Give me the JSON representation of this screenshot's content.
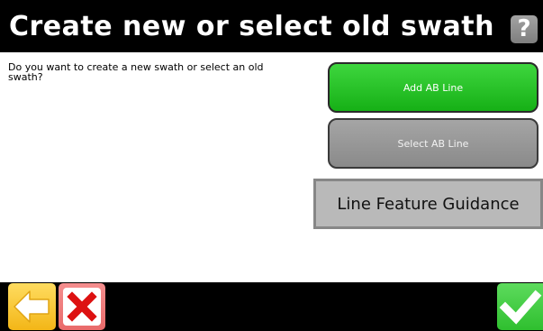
{
  "header": {
    "title": "Create new or select old swath",
    "help_icon": "question-mark-icon",
    "help_label": "?"
  },
  "main": {
    "prompt": "Do you want to create a new swath or select an old swath?",
    "buttons": {
      "add_ab_line": "Add AB Line",
      "select_ab_line": "Select AB Line",
      "line_feature_guidance": "Line Feature Guidance"
    }
  },
  "footer": {
    "back_icon": "arrow-left-icon",
    "cancel_icon": "close-x-icon",
    "ok_icon": "checkmark-icon"
  },
  "colors": {
    "header_bg": "#000000",
    "content_bg": "#ffffff",
    "add_button": "#22bb22",
    "select_button": "#999999",
    "back_button": "#f6c12d",
    "cancel_button": "#ee7777",
    "cancel_x": "#dd1111",
    "ok_button": "#3fcb3f"
  }
}
